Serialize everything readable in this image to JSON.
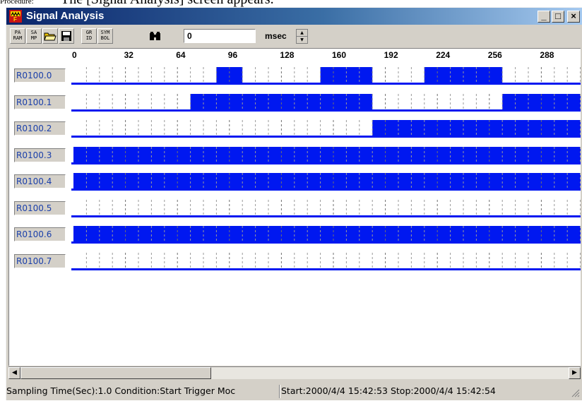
{
  "document": {
    "caption": "The [Signal Analysis] screen appears.",
    "overlay": "Procedure:"
  },
  "window": {
    "title": "Signal Analysis",
    "minimize": "_",
    "maximize": "□",
    "close": "×"
  },
  "toolbar": {
    "param_label": "PA\nRAM",
    "samp_label": "SA\nMP",
    "grid_label": "GR\nID",
    "symbol_label": "SYM\nBOL",
    "search_value": "0",
    "unit": "msec"
  },
  "ruler": {
    "ticks": [
      "0",
      "32",
      "64",
      "96",
      "128",
      "160",
      "192",
      "224",
      "256",
      "288"
    ]
  },
  "signals": [
    {
      "label": "R0100.0",
      "highs": [
        [
          11,
          13
        ],
        [
          19,
          23
        ],
        [
          27,
          33
        ]
      ]
    },
    {
      "label": "R0100.1",
      "highs": [
        [
          9,
          23
        ],
        [
          33,
          40
        ]
      ]
    },
    {
      "label": "R0100.2",
      "highs": [
        [
          23,
          40
        ]
      ]
    },
    {
      "label": "R0100.3",
      "highs": [
        [
          0,
          40
        ]
      ]
    },
    {
      "label": "R0100.4",
      "highs": [
        [
          0,
          40
        ]
      ]
    },
    {
      "label": "R0100.5",
      "highs": []
    },
    {
      "label": "R0100.6",
      "highs": [
        [
          0,
          40
        ]
      ]
    },
    {
      "label": "R0100.7",
      "highs": []
    }
  ],
  "colors": {
    "signal": "#0018f0",
    "grid": "#707070",
    "label_text": "#1a3faa"
  },
  "status": {
    "sampling": "Sampling Time(Sec):1.0  Condition:Start  Trigger Moc",
    "range": "Start:2000/4/4 15:42:53  Stop:2000/4/4 15:42:54"
  }
}
